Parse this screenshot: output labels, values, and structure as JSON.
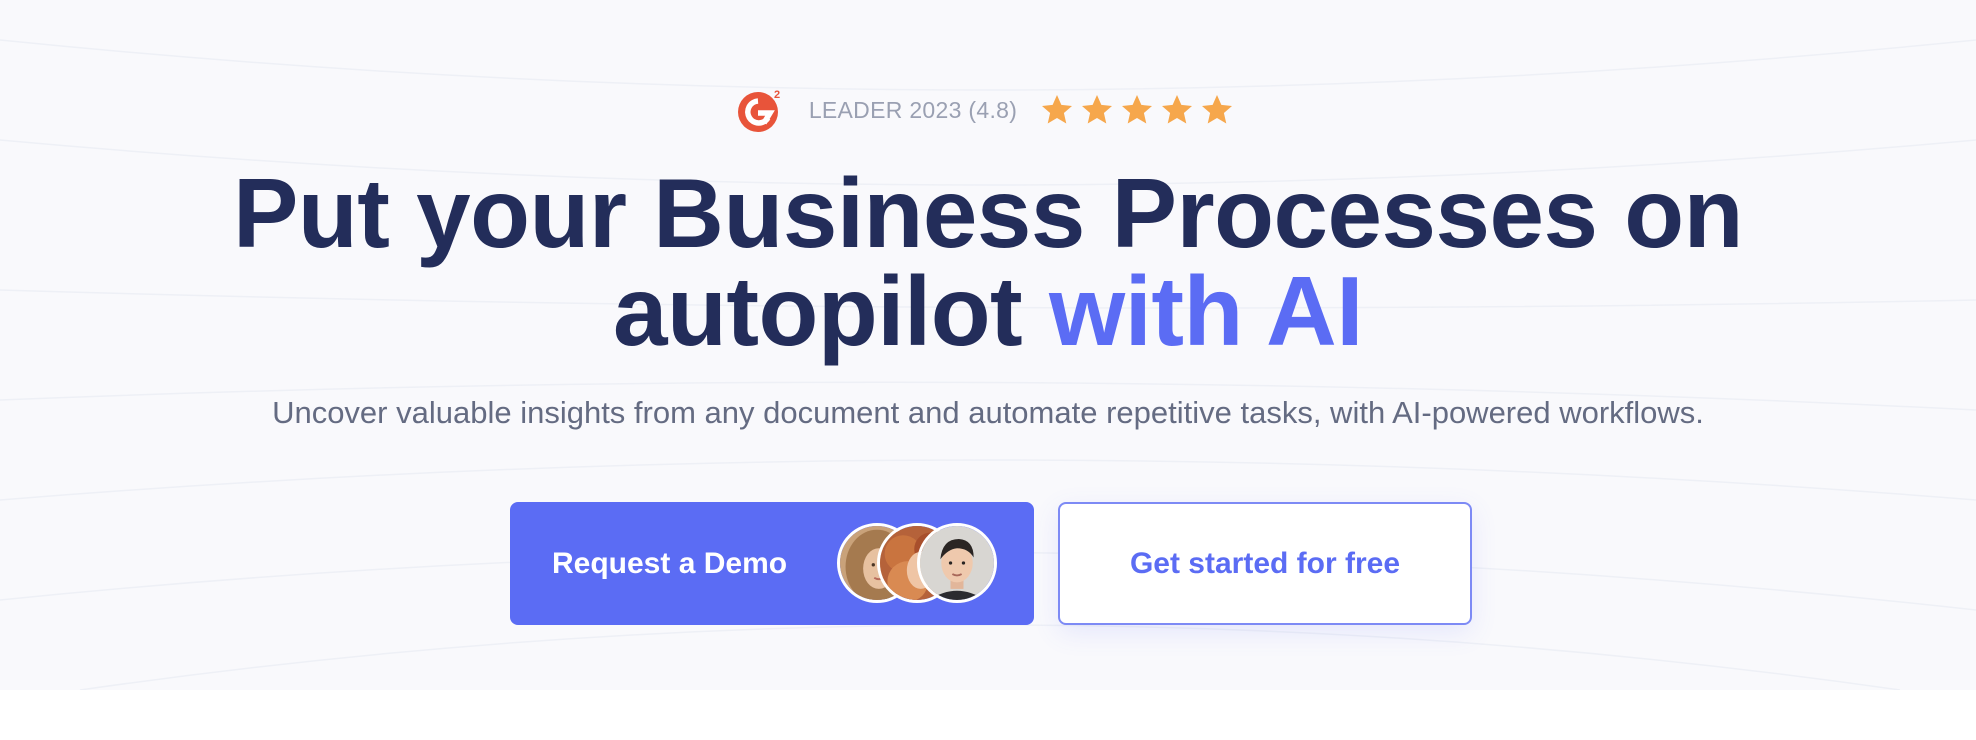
{
  "rating": {
    "logo_icon": "g2-logo-icon",
    "text": "LEADER 2023 (4.8)",
    "score": 4.8,
    "stars_shown": 5,
    "star_color": "#f6a74c"
  },
  "headline": {
    "line1": "Put your Business Processes on",
    "line2_prefix": "autopilot",
    "line2_accent": "with AI"
  },
  "subheadline": "Uncover valuable insights from any document and automate repetitive tasks, with AI-powered workflows.",
  "buttons": {
    "demo": {
      "label": "Request a Demo",
      "avatars": [
        "avatar-woman-blonde",
        "avatar-woman-redhead",
        "avatar-man-dark-hair"
      ]
    },
    "free": {
      "label": "Get started for free"
    }
  },
  "colors": {
    "headline": "#232d5a",
    "accent": "#5b6cf4",
    "subtext": "#646b82",
    "rating_text": "#9aa0b2",
    "g2_red": "#e8543a",
    "background": "#f9f9fc"
  }
}
